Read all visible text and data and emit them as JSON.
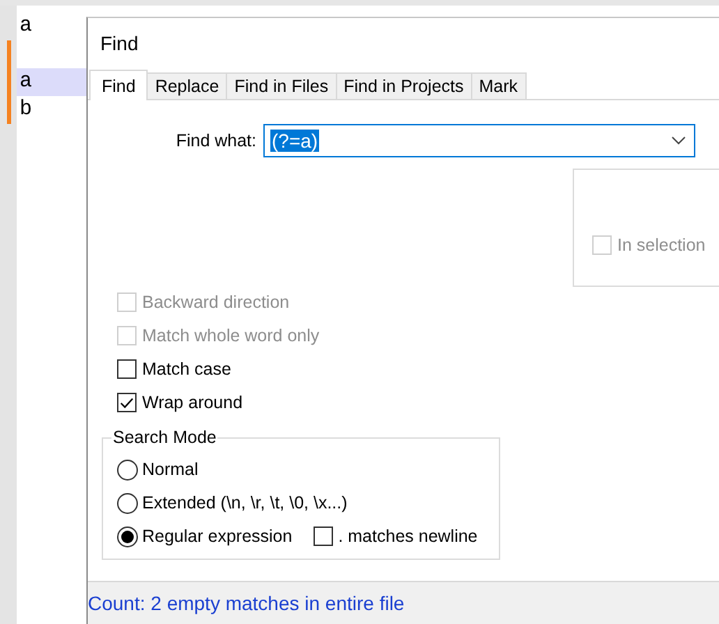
{
  "editor": {
    "lines": [
      {
        "text": "a",
        "changed": false,
        "current": false
      },
      {
        "changed": true,
        "current": false
      },
      {
        "text": "a",
        "changed": true,
        "current": true
      },
      {
        "text": "b",
        "changed": true,
        "current": false
      }
    ]
  },
  "dialog": {
    "title": "Find",
    "tabs": [
      {
        "label": "Find",
        "selected": true
      },
      {
        "label": "Replace",
        "selected": false
      },
      {
        "label": "Find in Files",
        "selected": false
      },
      {
        "label": "Find in Projects",
        "selected": false
      },
      {
        "label": "Mark",
        "selected": false
      }
    ],
    "find_what": {
      "label": "Find what:",
      "value": "(?=a)",
      "selected": true
    },
    "in_selection": {
      "label": "In selection",
      "checked": false,
      "disabled": true
    },
    "options": [
      {
        "label": "Backward direction",
        "checked": false,
        "disabled": true
      },
      {
        "label": "Match whole word only",
        "checked": false,
        "disabled": true
      },
      {
        "label": "Match case",
        "checked": false,
        "disabled": false
      },
      {
        "label": "Wrap around",
        "checked": true,
        "disabled": false
      }
    ],
    "search_mode": {
      "title": "Search Mode",
      "modes": [
        {
          "label": "Normal",
          "selected": false
        },
        {
          "label": "Extended (\\n, \\r, \\t, \\0, \\x...)",
          "selected": false
        },
        {
          "label": "Regular expression",
          "selected": true
        }
      ],
      "dot_matches_newline": {
        "label": ". matches newline",
        "checked": false,
        "disabled": false
      }
    },
    "status": "Count: 2 empty matches in entire file"
  }
}
